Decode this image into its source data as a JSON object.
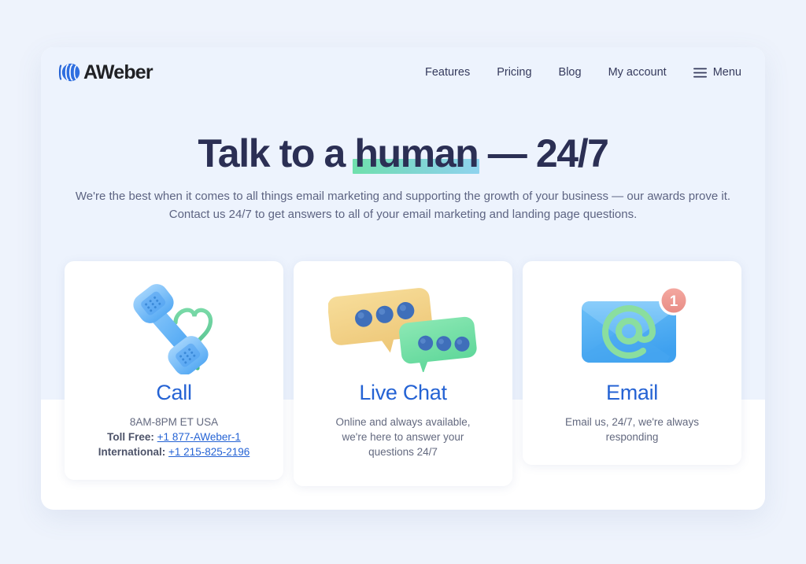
{
  "brand": {
    "name": "AWeber",
    "logo_icon": "aweber-logo-icon",
    "accent": "#2563d4"
  },
  "nav": {
    "items": [
      {
        "label": "Features"
      },
      {
        "label": "Pricing"
      },
      {
        "label": "Blog"
      },
      {
        "label": "My account"
      }
    ],
    "menu": {
      "label": "Menu",
      "icon": "hamburger-menu-icon"
    }
  },
  "hero": {
    "headline_before": "Talk to a ",
    "headline_highlight": "human",
    "headline_after": " — 24/7",
    "highlight_gradient_from": "#6fe0ac",
    "highlight_gradient_to": "#8fd3ee",
    "subhead_line1": "We're the best when it comes to all things email marketing and supporting the growth of your business — our awards prove it.",
    "subhead_line2": "Contact us 24/7 to get answers to all of your email marketing and landing page questions."
  },
  "cards": [
    {
      "id": "call",
      "icon": "phone-heart-icon",
      "title": "Call",
      "hours": "8AM-8PM ET USA",
      "tollfree_label": "Toll Free:",
      "tollfree_value": "+1 877-AWeber-1",
      "international_label": "International:",
      "international_value": "+1 215-825-2196"
    },
    {
      "id": "live-chat",
      "icon": "chat-bubbles-icon",
      "title": "Live Chat",
      "desc_line1": "Online and always available,",
      "desc_line2": "we're here to answer your",
      "desc_line3": "questions 24/7"
    },
    {
      "id": "email",
      "icon": "email-envelope-icon",
      "title": "Email",
      "badge": "1",
      "desc_line1": "Email us, 24/7, we're always",
      "desc_line2": "responding"
    }
  ]
}
